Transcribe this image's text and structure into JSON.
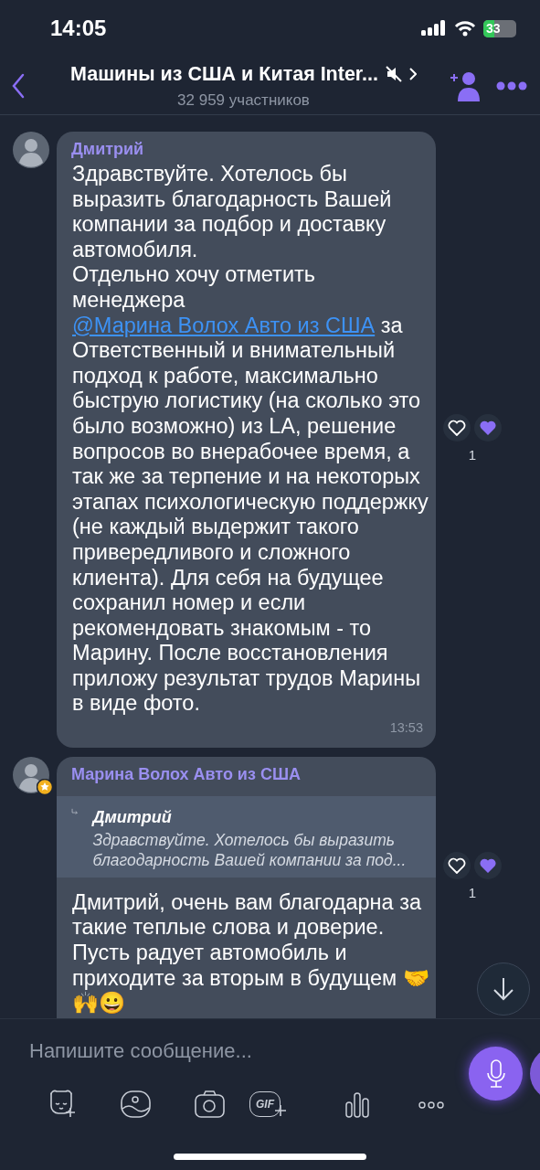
{
  "status_bar": {
    "time": "14:05",
    "battery": "33"
  },
  "header": {
    "title": "Машины из США и Китая Inter...",
    "subtitle": "32 959 участников",
    "muted": true
  },
  "messages": [
    {
      "author": "Дмитрий",
      "parts": [
        {
          "kind": "text",
          "text": "Здравствуйте. Хотелось бы выразить благодарность Вашей компании за подбор и доставку автомобиля.\nОтдельно хочу отметить менеджера "
        },
        {
          "kind": "mention",
          "text": "@Марина Волох Авто из США"
        },
        {
          "kind": "text",
          "text": " за Ответственный и внимательный подход к работе, максимально быструю логистику (на сколько это было возможно) из LA, решение вопросов во внерабочее время, а так же за терпение и на некоторых этапах психологическую поддержку (не каждый выдержит такого привередливого и сложного клиента). Для себя на будущее сохранил номер и если рекомендовать знакомым - то Марину. После восстановления приложу результат трудов Марины в виде фото."
        }
      ],
      "time": "13:53",
      "reactions": [
        {
          "kind": "outline"
        },
        {
          "kind": "filled"
        }
      ],
      "reaction_count": "1"
    },
    {
      "author": "Марина Волох Авто из США",
      "admin_badge": true,
      "reply": {
        "author": "Дмитрий",
        "text": "Здравствуйте. Хотелось бы выразить благодарность Вашей компании за под..."
      },
      "parts": [
        {
          "kind": "text",
          "text": "Дмитрий, очень вам благодарна за такие теплые слова и доверие. Пусть радует автомобиль и приходите за вторым в будущем 🤝🙌😀"
        }
      ],
      "reactions": [
        {
          "kind": "outline"
        },
        {
          "kind": "filled"
        }
      ],
      "reaction_count": "1"
    }
  ],
  "composer": {
    "placeholder": "Напишите сообщение..."
  },
  "toolbar": [
    {
      "kind": "sticker"
    },
    {
      "kind": "gallery"
    },
    {
      "kind": "camera"
    },
    {
      "kind": "gif",
      "label": "GIF"
    },
    {
      "kind": "poll"
    },
    {
      "kind": "more"
    }
  ]
}
